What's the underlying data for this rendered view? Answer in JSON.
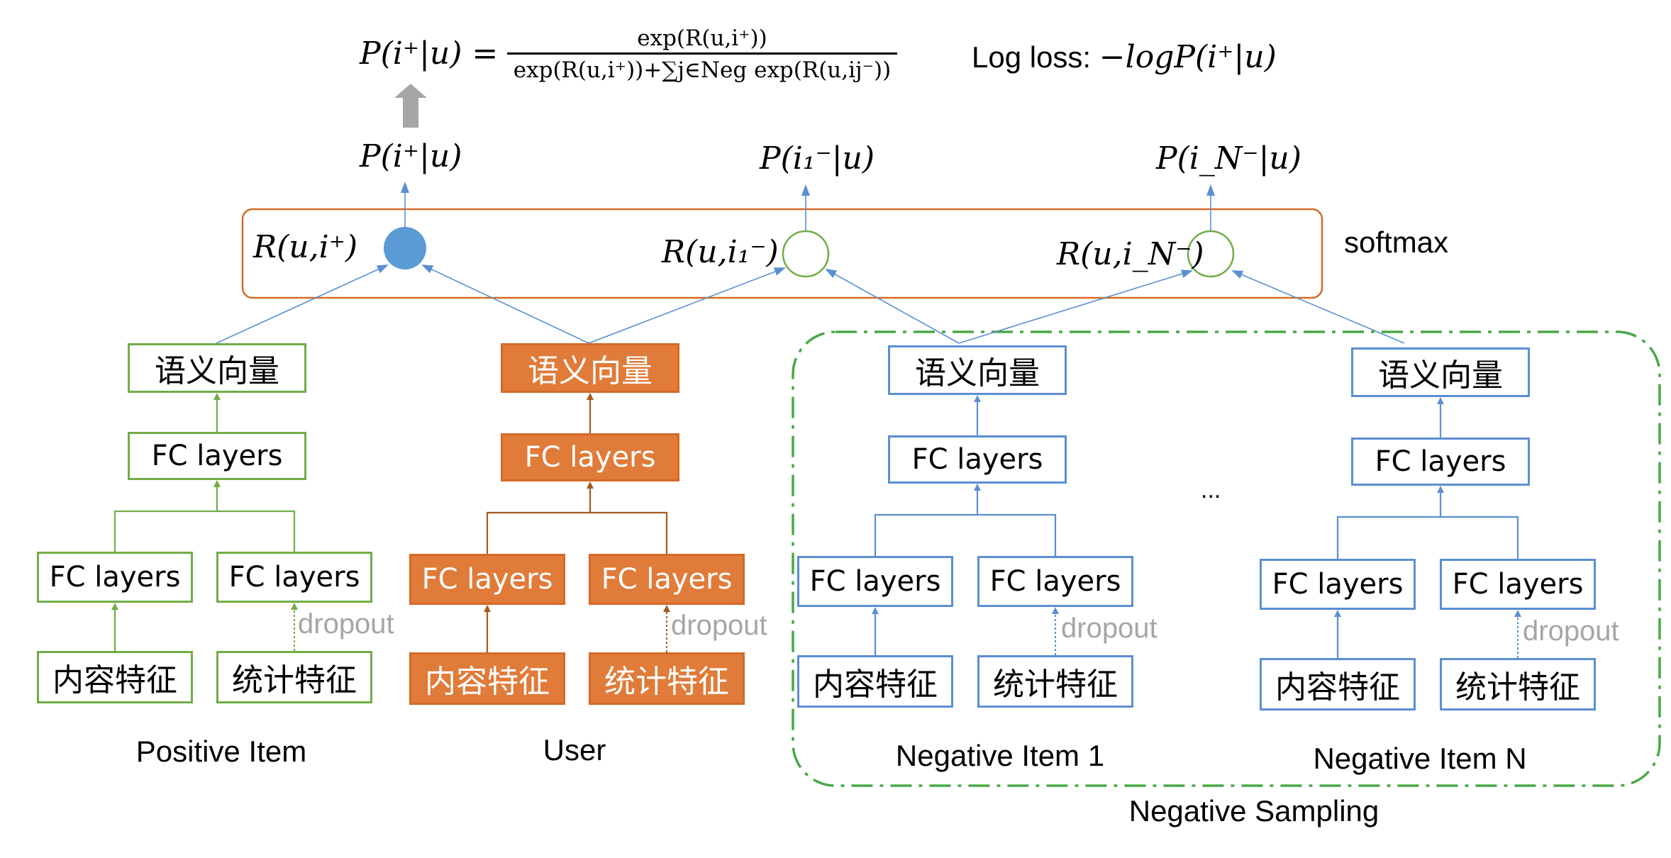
{
  "formula": {
    "lhs": "P(i⁺|u) =",
    "numerator": "exp(R(u,i⁺))",
    "denominator": "exp(R(u,i⁺))+∑j∈Neg exp(R(u,ij⁻))",
    "log_loss_label": "Log loss: ",
    "log_loss_expr": "−logP(i⁺|u)"
  },
  "softmax": {
    "label": "softmax"
  },
  "outputs": {
    "positive_prob": "P(i⁺|u)",
    "negative_1_prob": "P(i₁⁻|u)",
    "negative_n_prob": "P(i_N⁻|u)"
  },
  "scores": {
    "positive": "R(u,i⁺)",
    "negative_1": "R(u,i₁⁻)",
    "negative_n": "R(u,i_N⁻)"
  },
  "towers": [
    {
      "caption": "Positive Item",
      "semantic_vector": "语义向量",
      "fc_top": "FC layers",
      "fc_left": "FC layers",
      "fc_right": "FC layers",
      "content_feature": "内容特征",
      "stat_feature": "统计特征",
      "dropout": "dropout"
    },
    {
      "caption": "User",
      "semantic_vector": "语义向量",
      "fc_top": "FC layers",
      "fc_left": "FC layers",
      "fc_right": "FC layers",
      "content_feature": "内容特征",
      "stat_feature": "统计特征",
      "dropout": "dropout"
    },
    {
      "caption": "Negative Item 1",
      "semantic_vector": "语义向量",
      "fc_top": "FC layers",
      "fc_left": "FC layers",
      "fc_right": "FC layers",
      "content_feature": "内容特征",
      "stat_feature": "统计特征",
      "dropout": "dropout"
    },
    {
      "caption": "Negative Item N",
      "semantic_vector": "语义向量",
      "fc_top": "FC layers",
      "fc_left": "FC layers",
      "fc_right": "FC layers",
      "content_feature": "内容特征",
      "stat_feature": "统计特征",
      "dropout": "dropout"
    }
  ],
  "ellipsis": "...",
  "negative_sampling": {
    "label": "Negative Sampling"
  },
  "colors": {
    "positive": "#70ad47",
    "user": "#e07b39",
    "negative": "#5b8fd1",
    "softmax_border": "#d46a27",
    "sampling_border": "#4aa846",
    "positive_score_fill": "#5b9bd5",
    "negative_score_border": "#70ad47",
    "dropout_text": "#a6a6a6",
    "up_arrow": "#a6a6a6"
  }
}
